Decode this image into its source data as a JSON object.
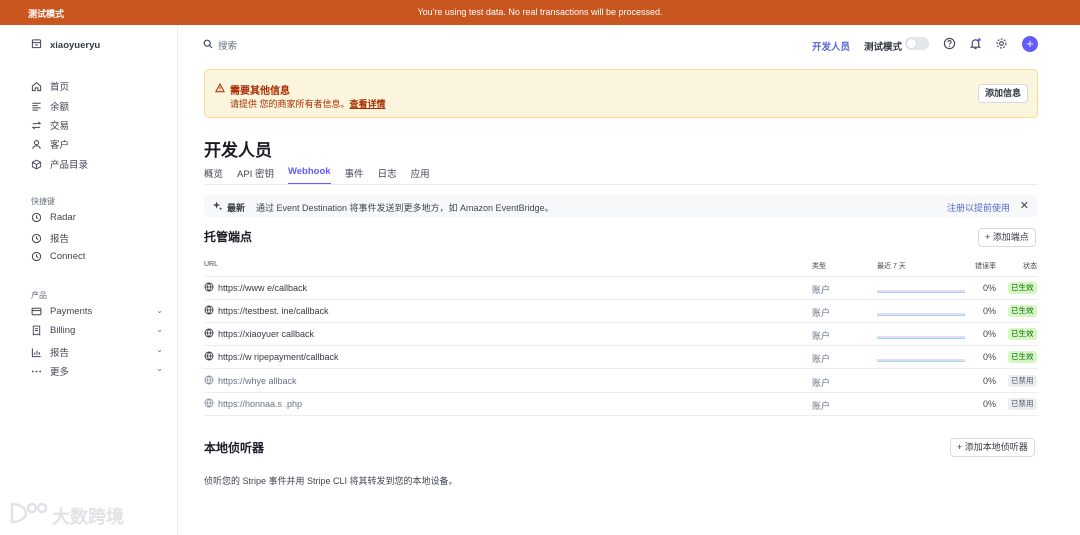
{
  "topbar": {
    "mode": "测试模式",
    "message": "You're using test data. No real transactions will be processed."
  },
  "sidebar": {
    "account": "xiaoyueryu",
    "main": [
      {
        "label": "首页",
        "icon": "home-icon"
      },
      {
        "label": "余额",
        "icon": "balance-icon"
      },
      {
        "label": "交易",
        "icon": "transactions-icon"
      },
      {
        "label": "客户",
        "icon": "customer-icon"
      },
      {
        "label": "产品目录",
        "icon": "product-icon"
      }
    ],
    "shortcuts_title": "快捷键",
    "shortcuts": [
      {
        "label": "Radar",
        "icon": "clock-icon"
      },
      {
        "label": "报告",
        "icon": "clock-icon"
      },
      {
        "label": "Connect",
        "icon": "clock-icon"
      }
    ],
    "products_title": "产品",
    "products": [
      {
        "label": "Payments",
        "icon": "payments-icon"
      },
      {
        "label": "Billing",
        "icon": "billing-icon"
      },
      {
        "label": "报告",
        "icon": "reports-icon"
      },
      {
        "label": "更多",
        "icon": "more-icon"
      }
    ]
  },
  "header": {
    "search": "搜索",
    "developers": "开发人员",
    "test_mode": "测试模式"
  },
  "banner": {
    "title": "需要其他信息",
    "text": "请提供 您的商家所有者信息。",
    "link": "查看详情",
    "button": "添加信息"
  },
  "page": {
    "title": "开发人员",
    "tabs": [
      "概览",
      "API 密钥",
      "Webhook",
      "事件",
      "日志",
      "应用"
    ],
    "active_tab": "Webhook"
  },
  "news": {
    "label": "最新",
    "text": "通过 Event Destination 将事件发送到更多地方，如 Amazon EventBridge。",
    "link": "注册以提前使用"
  },
  "hosted": {
    "title": "托管端点",
    "add_button": "添加端点",
    "columns": {
      "url": "URL",
      "type": "类型",
      "recent": "最近 7 天",
      "error_rate": "错误率",
      "status": "状态"
    },
    "rows": [
      {
        "url": "https://www                                                                    e/callback",
        "type": "账户",
        "error": "0%",
        "status": "已生效",
        "enabled": true
      },
      {
        "url": "https://testbest.                                                              ine/callback",
        "type": "账户",
        "error": "0%",
        "status": "已生效",
        "enabled": true
      },
      {
        "url": "https://xiaoyuer                                                                  callback",
        "type": "账户",
        "error": "0%",
        "status": "已生效",
        "enabled": true
      },
      {
        "url": "https://w                                                           ripepayment/callback",
        "type": "账户",
        "error": "0%",
        "status": "已生效",
        "enabled": true
      },
      {
        "url": "https://whye                                                                  allback",
        "type": "账户",
        "error": "0%",
        "status": "已禁用",
        "enabled": false
      },
      {
        "url": "https://honnaa.s                                       .php",
        "type": "账户",
        "error": "0%",
        "status": "已禁用",
        "enabled": false
      }
    ]
  },
  "local": {
    "title": "本地侦听器",
    "add_button": "添加本地侦听器",
    "desc": "侦听您的 Stripe 事件并用 Stripe CLI 将其转发到您的本地设备。"
  },
  "watermark": "大数跨境",
  "colors": {
    "accent": "#635bff",
    "topbar": "#c9551f",
    "warning_bg": "#fcf5dd",
    "active_badge": "#d7f7c2"
  }
}
